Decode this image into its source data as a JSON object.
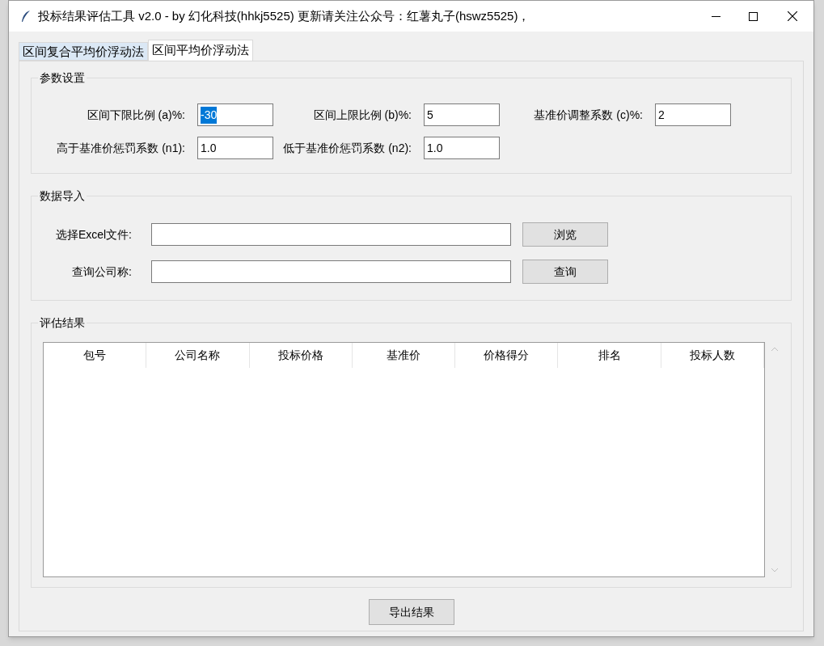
{
  "window": {
    "title": "投标结果评估工具 v2.0 - by 幻化科技(hhkj5525) 更新请关注公众号：红薯丸子(hswz5525)，"
  },
  "tabs": [
    {
      "label": "区间复合平均价浮动法",
      "selected": false
    },
    {
      "label": "区间平均价浮动法",
      "selected": true
    }
  ],
  "params": {
    "title": "参数设置",
    "rows": [
      [
        {
          "label": "区间下限比例 (a)%:",
          "value": "-30",
          "text_selected": true
        },
        {
          "label": "区间上限比例 (b)%:",
          "value": "5",
          "text_selected": false
        },
        {
          "label": "基准价调整系数 (c)%:",
          "value": "2",
          "text_selected": false
        }
      ],
      [
        {
          "label": "高于基准价惩罚系数 (n1):",
          "value": "1.0",
          "text_selected": false
        },
        {
          "label": "低于基准价惩罚系数 (n2):",
          "value": "1.0",
          "text_selected": false
        }
      ]
    ]
  },
  "import": {
    "title": "数据导入",
    "rows": [
      {
        "label": "选择Excel文件:",
        "button": "浏览"
      },
      {
        "label": "查询公司称:",
        "button": "查询"
      }
    ]
  },
  "results": {
    "title": "评估结果",
    "columns": [
      "包号",
      "公司名称",
      "投标价格",
      "基准价",
      "价格得分",
      "排名",
      "投标人数"
    ]
  },
  "export_button": "导出结果"
}
